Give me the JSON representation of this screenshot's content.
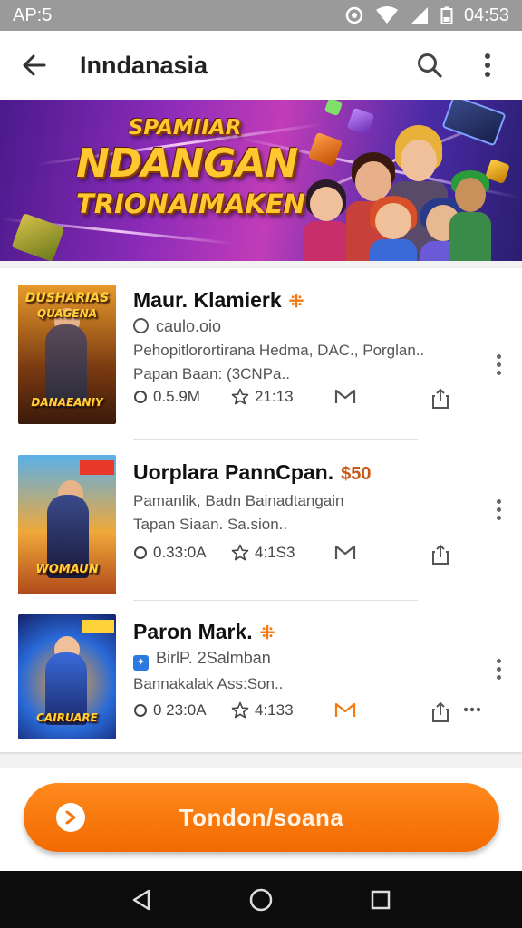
{
  "status_bar": {
    "time_left": "AP:5",
    "time_right": "04:53"
  },
  "app_bar": {
    "title": "Inndanasia"
  },
  "banner": {
    "line1": "SPAMIIAR",
    "line2": "NDANGAN",
    "line3": "TRIONAIMAKEN"
  },
  "items": [
    {
      "thumb_title": "DUSHARIAS",
      "thumb_sub": "QUAGENA",
      "thumb_bottom": "DANAEANIY",
      "title": "Maur. Klamierk",
      "badge": "⁜",
      "subtitle": "caulo.oio",
      "desc1": "Pehopitlorortirana Hedma, DAC., Porglan..",
      "desc2": "Papan Baan: (3CNPa..",
      "downloads": "0.5.9M",
      "rating": "21:13",
      "stat3": "M"
    },
    {
      "thumb_title": "",
      "thumb_sub": "",
      "thumb_bottom": "WOMAUN",
      "title": "Uorplara PannCpan.",
      "badge": "$50",
      "subtitle": "",
      "desc1": "Pamanlik, Badn Bainadtangain",
      "desc2": "Tapan Siaan. Sa.sion..",
      "downloads": "0.33:0A",
      "rating": "4:1S3",
      "stat3": "M"
    },
    {
      "thumb_title": "",
      "thumb_sub": "",
      "thumb_bottom": "CAIRUARE",
      "title": "Paron Mark.",
      "badge": "⁜",
      "subtitle": "BirlP. 2Salmban",
      "desc1": "Bannakalak Ass:Son..",
      "desc2": "",
      "downloads": "0 23:0A",
      "rating": "4:133",
      "stat3": "M"
    }
  ],
  "cta": {
    "label": "Tondon/soana"
  },
  "colors": {
    "accent": "#f47a10",
    "banner_text": "#ffc830",
    "status_bar": "#9a9a9a"
  }
}
